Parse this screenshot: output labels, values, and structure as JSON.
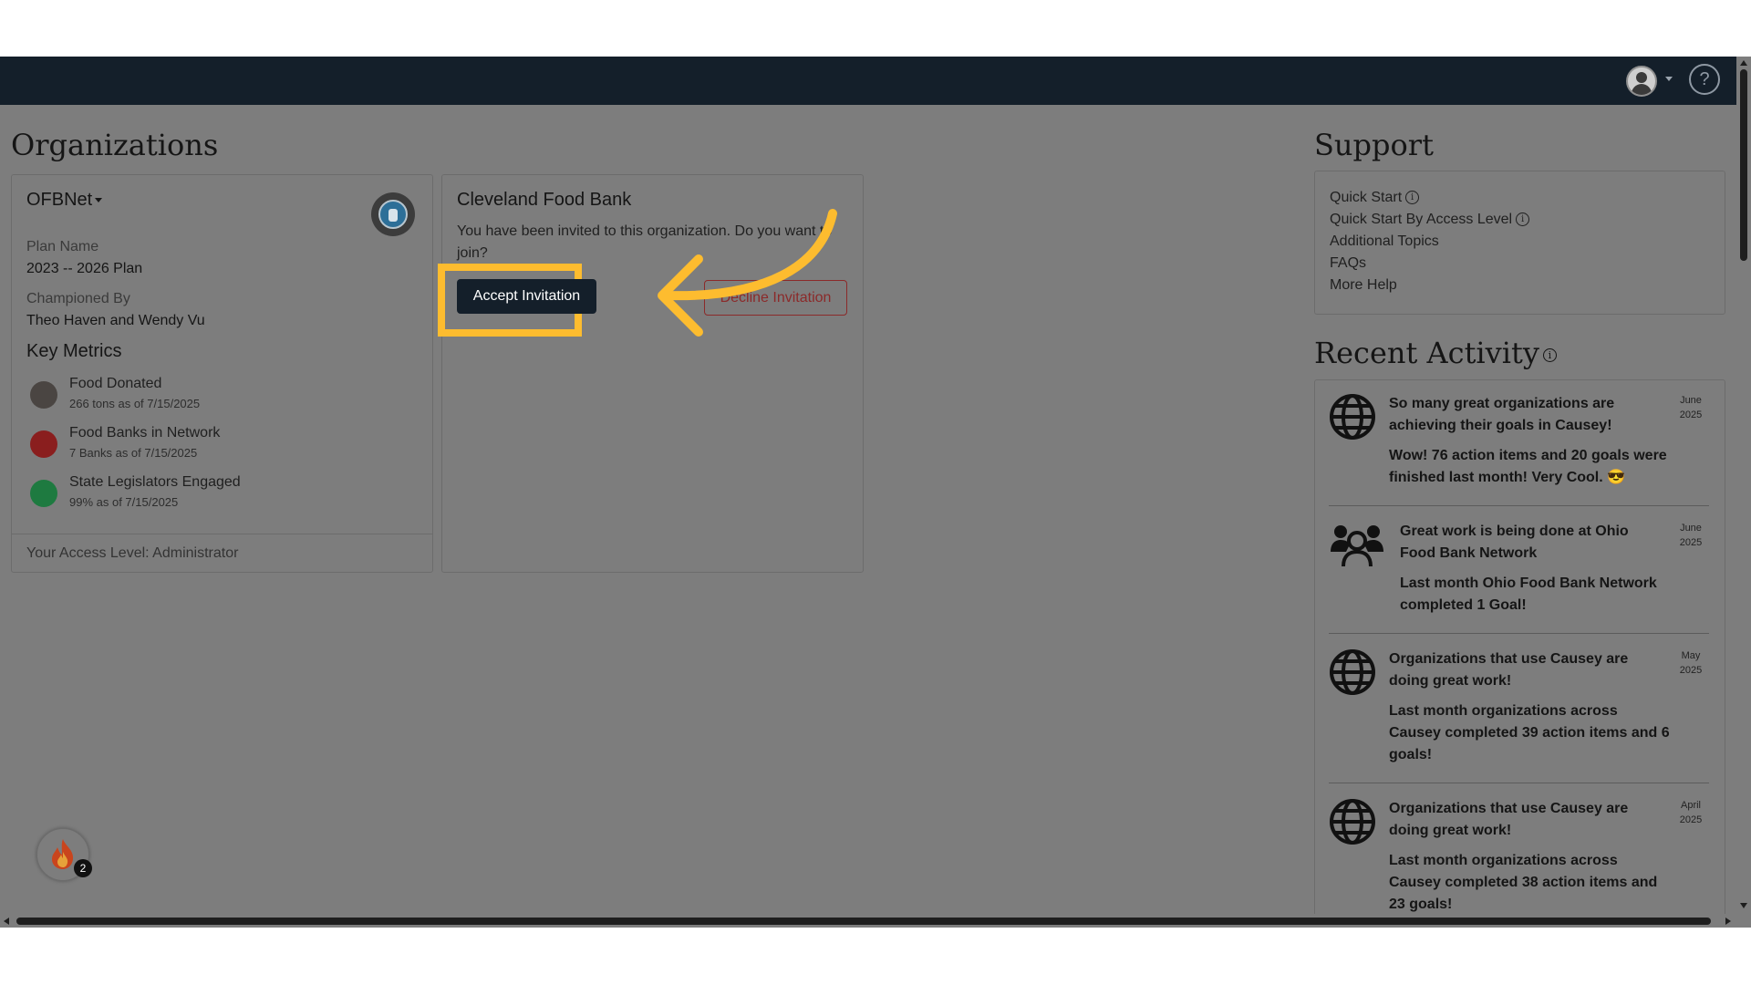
{
  "topbar": {
    "avatar_icon": "user-avatar",
    "help_icon": "question-circle-icon",
    "help_glyph": "?"
  },
  "organizations": {
    "heading": "Organizations",
    "ofbnet": {
      "name": "OFBNet",
      "plan_label": "Plan Name",
      "plan_value": "2023 -- 2026 Plan",
      "champion_label": "Championed By",
      "champion_value": "Theo Haven and Wendy Vu",
      "metrics_heading": "Key Metrics",
      "metrics": [
        {
          "name": "Food Donated",
          "sub": "266 tons as of 7/15/2025",
          "color": "#4a4542"
        },
        {
          "name": "Food Banks in Network",
          "sub": "7 Banks as of 7/15/2025",
          "color": "#8a1e1e"
        },
        {
          "name": "State Legislators Engaged",
          "sub": "99% as of 7/15/2025",
          "color": "#1e7a40"
        }
      ],
      "access_level": "Your Access Level: Administrator"
    },
    "invite": {
      "title": "Cleveland Food Bank",
      "message": "You have been invited to this organization. Do you want to join?",
      "accept_label": "Accept Invitation",
      "decline_label": "Decline Invitation"
    }
  },
  "support": {
    "heading": "Support",
    "links": [
      "Quick Start",
      "Quick Start By Access Level",
      "Additional Topics",
      "FAQs",
      "More Help"
    ]
  },
  "recent_activity": {
    "heading": "Recent Activity",
    "items": [
      {
        "icon": "globe-icon",
        "title": "So many great organizations are achieving their goals in Causey!",
        "body": "Wow! 76 action items and 20 goals were finished last month! Very Cool. 😎",
        "month": "June",
        "year": "2025"
      },
      {
        "icon": "users-icon",
        "title": "Great work is being done at Ohio Food Bank Network",
        "body": "Last month Ohio Food Bank Network completed 1 Goal!",
        "month": "June",
        "year": "2025"
      },
      {
        "icon": "globe-icon",
        "title": "Organizations that use Causey are doing great work!",
        "body": "Last month organizations across Causey completed 39 action items and 6 goals!",
        "month": "May",
        "year": "2025"
      },
      {
        "icon": "globe-icon",
        "title": "Organizations that use Causey are doing great work!",
        "body": "Last month organizations across Causey completed 38 action items and 23 goals!",
        "month": "April",
        "year": "2025"
      }
    ]
  },
  "notifications": {
    "icon": "fire-icon",
    "count": "2"
  },
  "colors": {
    "highlight": "#fdbc2f",
    "navbar": "#141f2a",
    "overlay": "#7d7d7d",
    "decline": "#8b2a2a"
  }
}
